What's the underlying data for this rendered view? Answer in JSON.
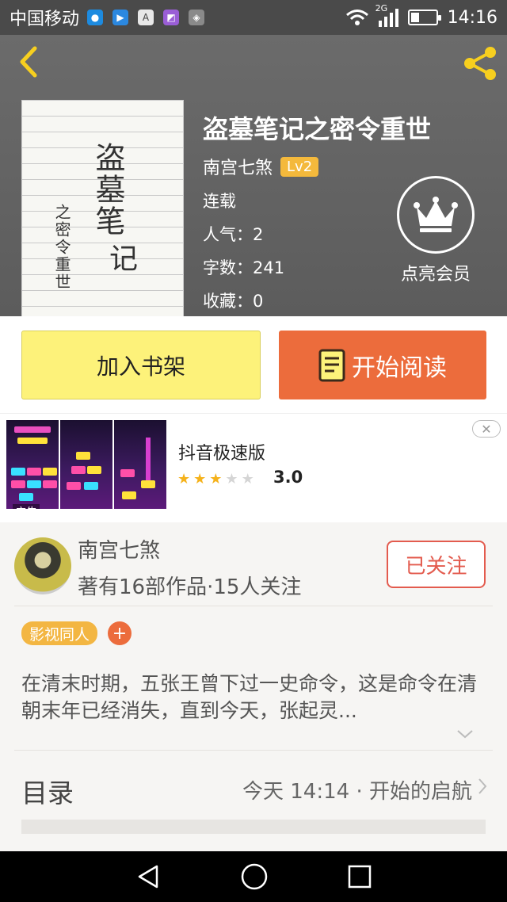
{
  "status_bar": {
    "carrier": "中国移动",
    "network": "2G",
    "time": "14:16",
    "battery_level": 0.35
  },
  "book": {
    "title": "盗墓笔记之密令重世",
    "author": "南宫七煞",
    "level": "Lv2",
    "status": "连载",
    "popularity_label": "人气：",
    "popularity": "2",
    "word_count_label": "字数：",
    "word_count": "241",
    "favorites_label": "收藏：",
    "favorites": "0",
    "vip_label": "点亮会员"
  },
  "actions": {
    "add_shelf_label": "加入书架",
    "start_reading_label": "开始阅读"
  },
  "ad": {
    "app_name": "抖音极速版",
    "rating": "3.0",
    "rating_value": 3,
    "tag": "广告"
  },
  "author_card": {
    "name": "南宫七煞",
    "stats": "著有16部作品·15人关注",
    "follow_label": "已关注",
    "tag": "影视同人",
    "tag_add": "+",
    "synopsis": "在清末时期，五张王曾下过一史命令，这是命令在清朝末年已经消失，直到今天，张起灵..."
  },
  "toc": {
    "label": "目录",
    "latest": "今天 14:14 · 开始的启航"
  },
  "colors": {
    "accent_orange": "#ec6c3c",
    "shelf_yellow": "#fdf27a",
    "badge_gold": "#f4b93c",
    "follow_red": "#e35b4e"
  },
  "icons": [
    "back-icon",
    "share-icon",
    "crown-icon",
    "book-icon",
    "close-icon",
    "chevron-down-icon",
    "chevron-right-icon",
    "nav-back-icon",
    "nav-home-icon",
    "nav-recent-icon"
  ]
}
